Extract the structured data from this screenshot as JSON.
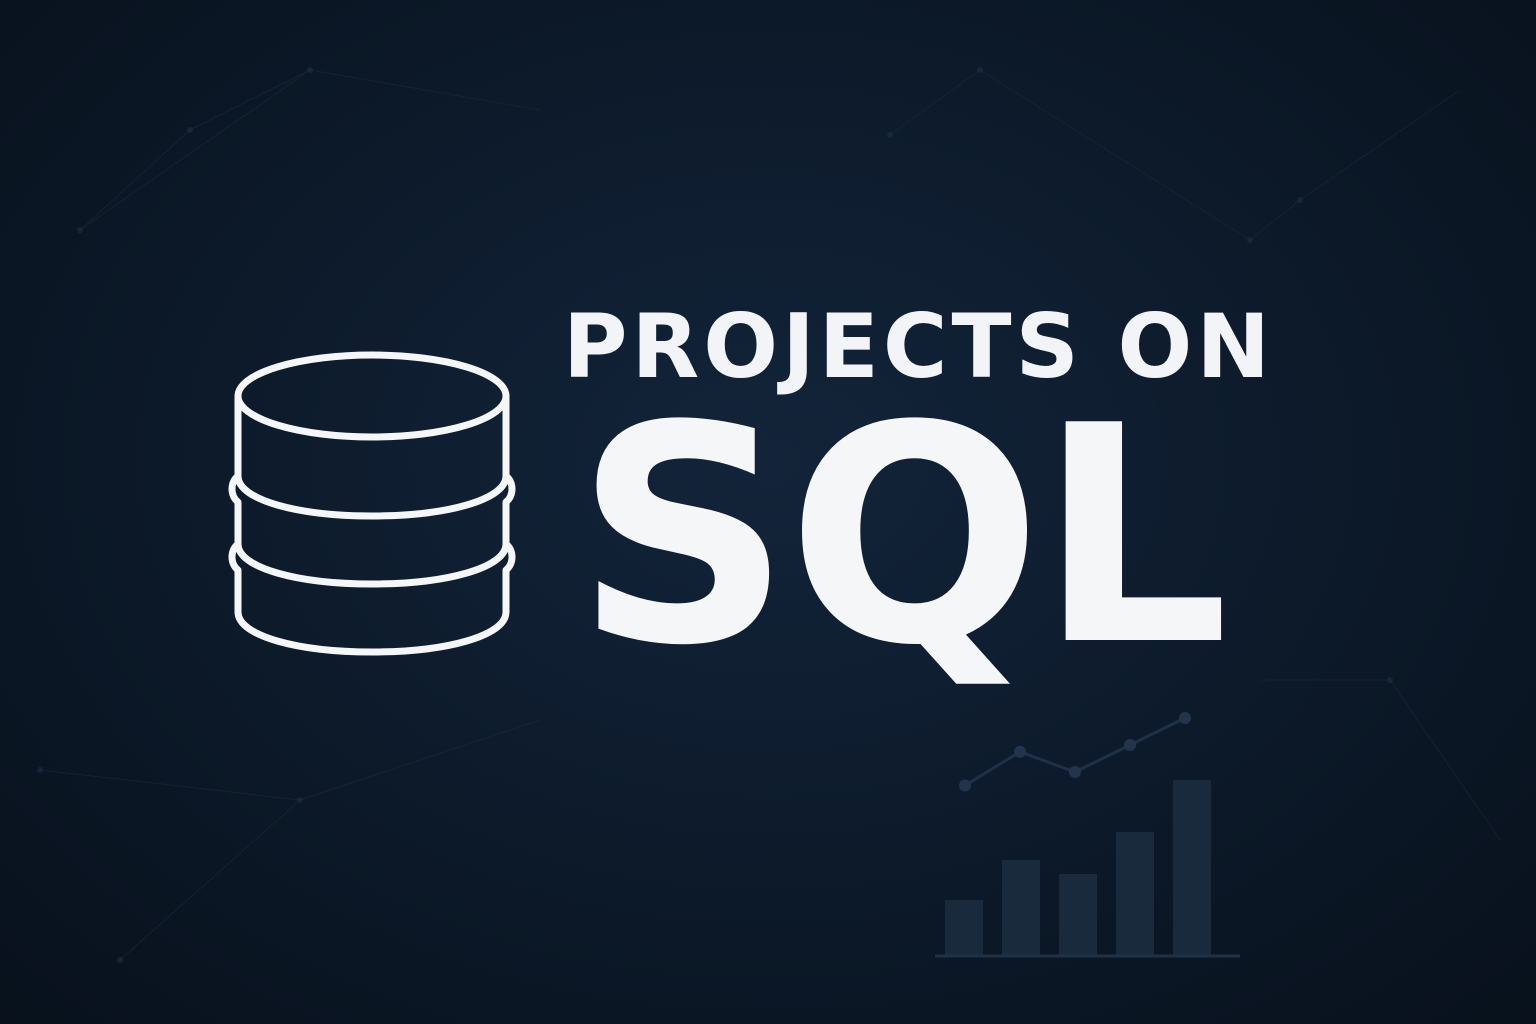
{
  "title": {
    "line1": "PROJECTS ON",
    "line2": "SQL"
  },
  "icons": {
    "main": "database-icon",
    "decoration": "bar-chart-icon"
  },
  "colors": {
    "background": "#0d1b2c",
    "text": "#f4f6f8",
    "icon_stroke": "#f4f6f8",
    "decoration": "#1a2a3d"
  },
  "decoration_chart": {
    "bar_levels": [
      0.28,
      0.48,
      0.41,
      0.62,
      0.88
    ],
    "trend_levels": [
      0.5,
      0.75,
      0.6,
      0.8,
      1.0
    ]
  }
}
